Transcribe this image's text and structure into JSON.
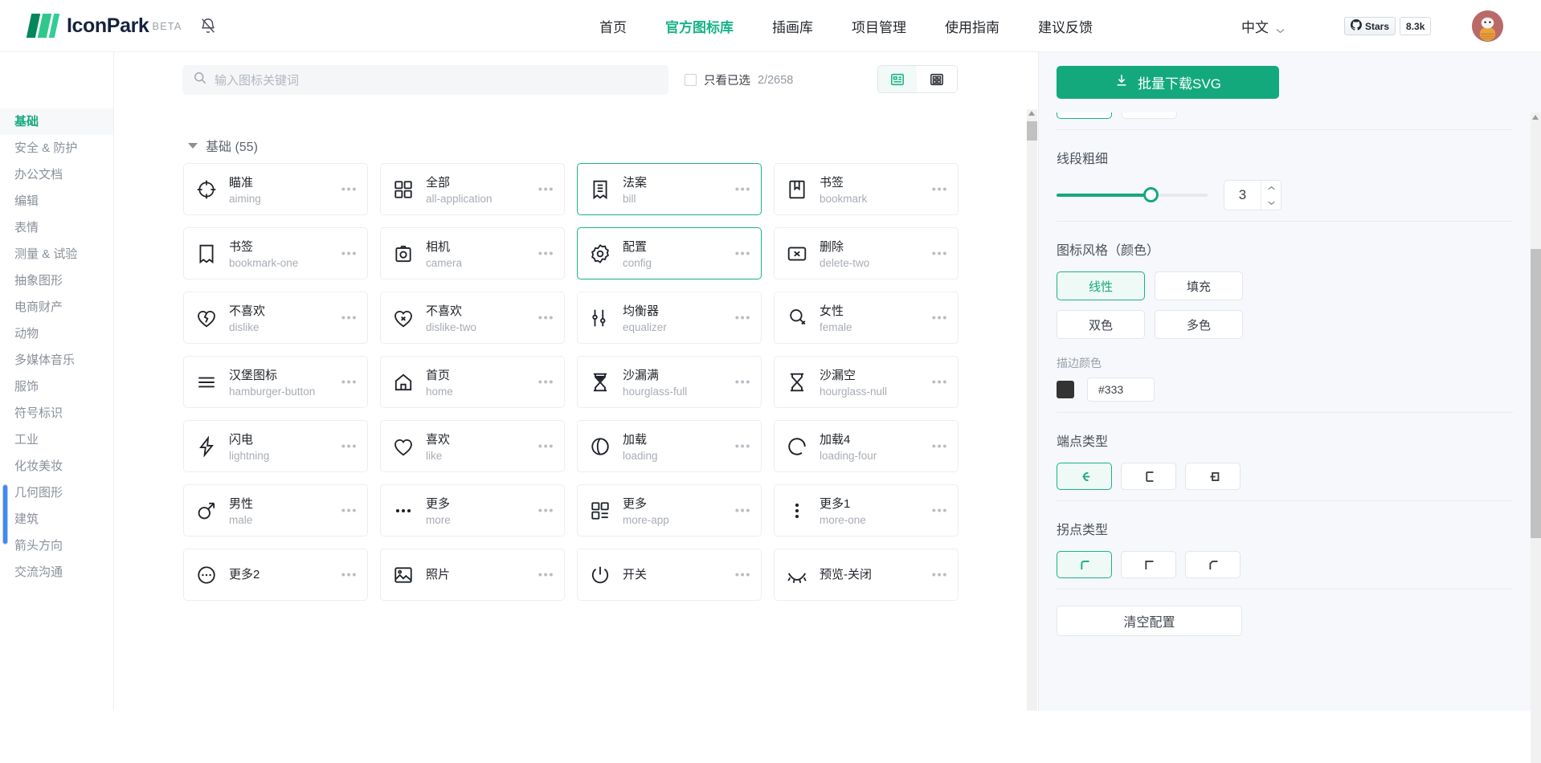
{
  "header": {
    "brand": "IconPark",
    "beta": "BETA",
    "bell_icon": "bell-off-icon",
    "nav": [
      {
        "label": "首页",
        "active": false
      },
      {
        "label": "官方图标库",
        "active": true
      },
      {
        "label": "插画库",
        "active": false
      },
      {
        "label": "项目管理",
        "active": false
      },
      {
        "label": "使用指南",
        "active": false
      },
      {
        "label": "建议反馈",
        "active": false
      }
    ],
    "language": "中文",
    "language_chevron_icon": "chevron-down-icon",
    "github_icon": "github-icon",
    "stars_label": "Stars",
    "stars_count": "8.3k",
    "avatar_icon": "user-avatar",
    "accent_color": "#19b389"
  },
  "sidebar": {
    "items": [
      {
        "label": "基础",
        "active": true
      },
      {
        "label": "安全 & 防护",
        "active": false
      },
      {
        "label": "办公文档",
        "active": false
      },
      {
        "label": "编辑",
        "active": false
      },
      {
        "label": "表情",
        "active": false
      },
      {
        "label": "测量 & 试验",
        "active": false
      },
      {
        "label": "抽象图形",
        "active": false
      },
      {
        "label": "电商财产",
        "active": false
      },
      {
        "label": "动物",
        "active": false
      },
      {
        "label": "多媒体音乐",
        "active": false
      },
      {
        "label": "服饰",
        "active": false
      },
      {
        "label": "符号标识",
        "active": false
      },
      {
        "label": "工业",
        "active": false
      },
      {
        "label": "化妆美妆",
        "active": false
      },
      {
        "label": "几何图形",
        "active": false
      },
      {
        "label": "建筑",
        "active": false
      },
      {
        "label": "箭头方向",
        "active": false
      },
      {
        "label": "交流沟通",
        "active": false
      }
    ]
  },
  "search": {
    "placeholder": "输入图标关键词",
    "value": "",
    "search_icon": "search-icon",
    "only_selected_label": "只看已选",
    "only_selected_count": "2/2658",
    "checkbox_checked": false,
    "view_list_icon": "list-view-icon",
    "view_grid_icon": "grid-view-icon",
    "view_active": "list"
  },
  "main": {
    "group_title": "基础 (55)",
    "caret_icon": "caret-down-icon",
    "more_icon": "ellipsis-icon",
    "icons": [
      {
        "cn": "瞄准",
        "en": "aiming",
        "glyph": "aiming-icon",
        "selected": false
      },
      {
        "cn": "全部",
        "en": "all-application",
        "glyph": "all-application-icon",
        "selected": false
      },
      {
        "cn": "法案",
        "en": "bill",
        "glyph": "bill-icon",
        "selected": true
      },
      {
        "cn": "书签",
        "en": "bookmark",
        "glyph": "bookmark-icon",
        "selected": false
      },
      {
        "cn": "书签",
        "en": "bookmark-one",
        "glyph": "bookmark-one-icon",
        "selected": false
      },
      {
        "cn": "相机",
        "en": "camera",
        "glyph": "camera-icon",
        "selected": false
      },
      {
        "cn": "配置",
        "en": "config",
        "glyph": "config-icon",
        "selected": true
      },
      {
        "cn": "删除",
        "en": "delete-two",
        "glyph": "delete-two-icon",
        "selected": false
      },
      {
        "cn": "不喜欢",
        "en": "dislike",
        "glyph": "dislike-icon",
        "selected": false
      },
      {
        "cn": "不喜欢",
        "en": "dislike-two",
        "glyph": "dislike-two-icon",
        "selected": false
      },
      {
        "cn": "均衡器",
        "en": "equalizer",
        "glyph": "equalizer-icon",
        "selected": false
      },
      {
        "cn": "女性",
        "en": "female",
        "glyph": "female-icon",
        "selected": false
      },
      {
        "cn": "汉堡图标",
        "en": "hamburger-button",
        "glyph": "hamburger-button-icon",
        "selected": false
      },
      {
        "cn": "首页",
        "en": "home",
        "glyph": "home-icon",
        "selected": false
      },
      {
        "cn": "沙漏满",
        "en": "hourglass-full",
        "glyph": "hourglass-full-icon",
        "selected": false
      },
      {
        "cn": "沙漏空",
        "en": "hourglass-null",
        "glyph": "hourglass-null-icon",
        "selected": false
      },
      {
        "cn": "闪电",
        "en": "lightning",
        "glyph": "lightning-icon",
        "selected": false
      },
      {
        "cn": "喜欢",
        "en": "like",
        "glyph": "like-icon",
        "selected": false
      },
      {
        "cn": "加载",
        "en": "loading",
        "glyph": "loading-icon",
        "selected": false
      },
      {
        "cn": "加载4",
        "en": "loading-four",
        "glyph": "loading-four-icon",
        "selected": false
      },
      {
        "cn": "男性",
        "en": "male",
        "glyph": "male-icon",
        "selected": false
      },
      {
        "cn": "更多",
        "en": "more",
        "glyph": "more-icon",
        "selected": false
      },
      {
        "cn": "更多",
        "en": "more-app",
        "glyph": "more-app-icon",
        "selected": false
      },
      {
        "cn": "更多1",
        "en": "more-one",
        "glyph": "more-one-icon",
        "selected": false
      },
      {
        "cn": "更多2",
        "en": "",
        "glyph": "more-two-icon",
        "selected": false
      },
      {
        "cn": "照片",
        "en": "",
        "glyph": "photo-icon",
        "selected": false
      },
      {
        "cn": "开关",
        "en": "",
        "glyph": "power-icon",
        "selected": false
      },
      {
        "cn": "预览-关闭",
        "en": "",
        "glyph": "preview-close-icon",
        "selected": false
      }
    ]
  },
  "panel": {
    "download_label": "批量下载SVG",
    "download_icon": "download-icon",
    "stroke_width": {
      "title": "线段粗细",
      "value": "3",
      "up_icon": "chevron-up-icon",
      "down_icon": "chevron-down-icon"
    },
    "style": {
      "title": "图标风格（颜色）",
      "options": [
        {
          "label": "线性",
          "selected": true
        },
        {
          "label": "填充",
          "selected": false
        },
        {
          "label": "双色",
          "selected": false
        },
        {
          "label": "多色",
          "selected": false
        }
      ]
    },
    "stroke_color": {
      "label": "描边颜色",
      "value": "#333",
      "swatch": "#333333"
    },
    "linecap": {
      "title": "端点类型",
      "options": [
        {
          "icon": "linecap-round-icon",
          "selected": true
        },
        {
          "icon": "linecap-butt-icon",
          "selected": false
        },
        {
          "icon": "linecap-square-icon",
          "selected": false
        }
      ]
    },
    "linejoin": {
      "title": "拐点类型",
      "options": [
        {
          "icon": "linejoin-round-icon",
          "selected": true
        },
        {
          "icon": "linejoin-miter-icon",
          "selected": false
        },
        {
          "icon": "linejoin-bevel-icon",
          "selected": false
        }
      ]
    },
    "clear_label": "清空配置"
  }
}
